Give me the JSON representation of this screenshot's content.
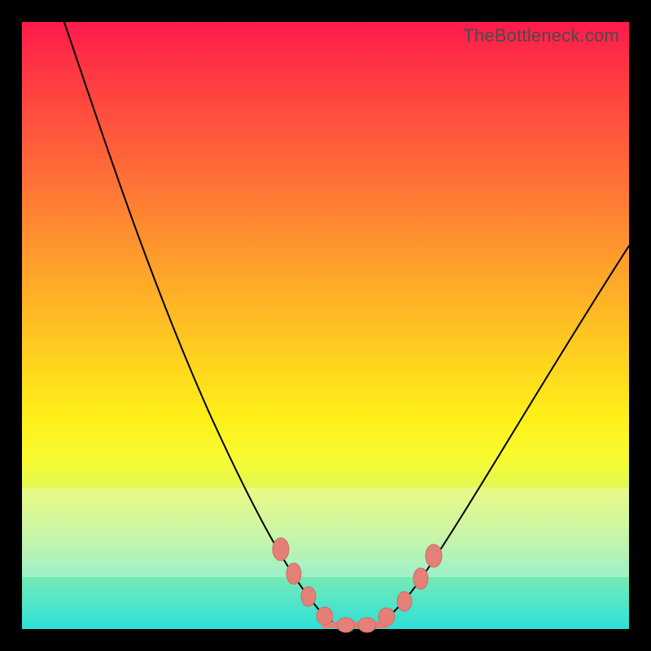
{
  "attribution": "TheBottleneck.com",
  "colors": {
    "gradient_top": "#ff1a4d",
    "gradient_bottom": "#2de0d8",
    "curve": "#000000",
    "marker": "#e58078",
    "frame": "#000000"
  },
  "chart_data": {
    "type": "line",
    "title": "",
    "xlabel": "",
    "ylabel": "",
    "xlim": [
      0,
      100
    ],
    "ylim": [
      0,
      100
    ],
    "x": [
      0,
      5,
      10,
      15,
      20,
      25,
      30,
      35,
      40,
      45,
      47,
      49,
      51,
      53,
      55,
      57,
      60,
      65,
      70,
      75,
      80,
      85,
      90,
      95,
      100
    ],
    "values": [
      103,
      91,
      79,
      67,
      55,
      43,
      33,
      23,
      14,
      6,
      3,
      1,
      0,
      0,
      0,
      1,
      3,
      8,
      15,
      23,
      31,
      39,
      47,
      55,
      63
    ],
    "annotations": [
      {
        "x": 41,
        "y": 13,
        "kind": "marker"
      },
      {
        "x": 43,
        "y": 9,
        "kind": "marker"
      },
      {
        "x": 46,
        "y": 4,
        "kind": "marker"
      },
      {
        "x": 49,
        "y": 1,
        "kind": "marker"
      },
      {
        "x": 52,
        "y": 0,
        "kind": "marker"
      },
      {
        "x": 55,
        "y": 0,
        "kind": "marker"
      },
      {
        "x": 58,
        "y": 2,
        "kind": "marker"
      },
      {
        "x": 61,
        "y": 5,
        "kind": "marker"
      },
      {
        "x": 64,
        "y": 9,
        "kind": "marker"
      },
      {
        "x": 66,
        "y": 13,
        "kind": "marker"
      }
    ],
    "note": "V-shaped bottleneck curve over a vertical red-to-teal gradient. Minimum is a flat segment around x≈50–56. No axis ticks or labels are shown in the source image."
  }
}
